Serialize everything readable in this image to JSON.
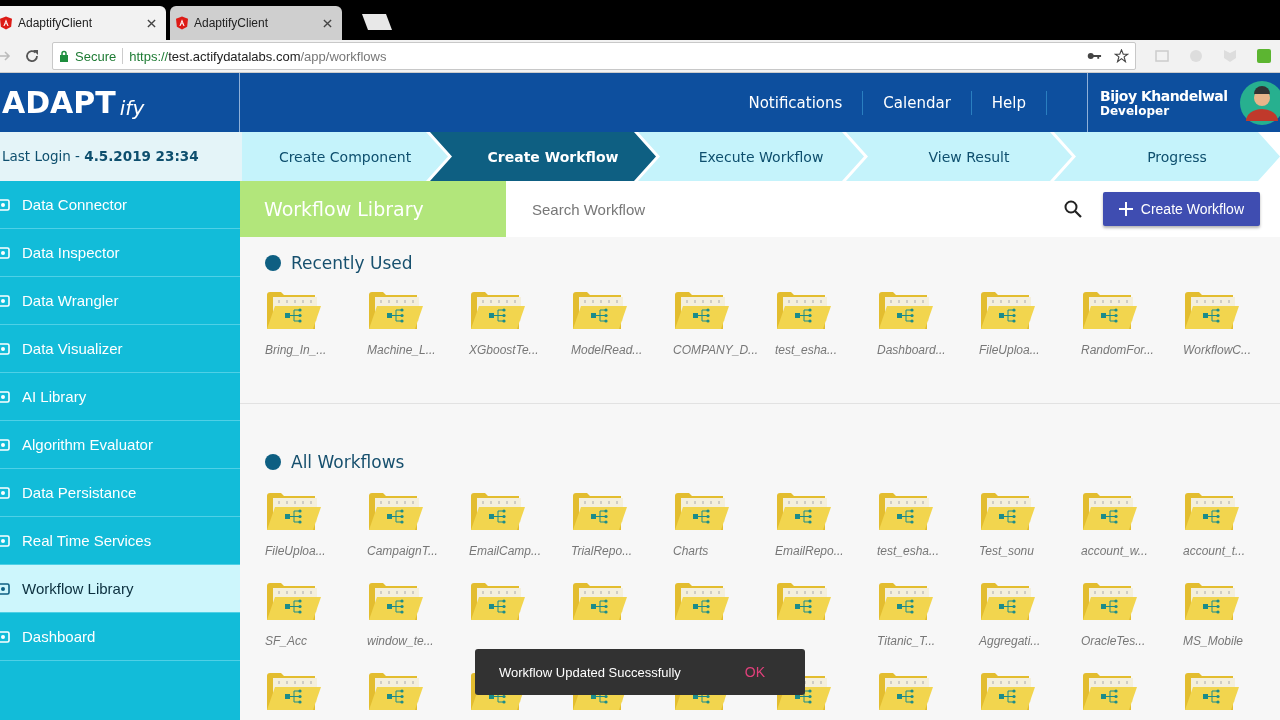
{
  "browser": {
    "tabs": [
      {
        "title": "AdaptifyClient",
        "selected": true
      },
      {
        "title": "AdaptifyClient",
        "selected": false
      }
    ],
    "secure_label": "Secure",
    "url_scheme": "https://",
    "url_host": "test.actifydatalabs.com",
    "url_path": "/app/workflows"
  },
  "header": {
    "logo_main": "ADAPT",
    "logo_suffix": "ify",
    "nav": [
      "Notifications",
      "Calendar",
      "Help"
    ],
    "user_name": "Bijoy Khandelwal",
    "user_role": "Developer"
  },
  "last_login": "Last Login - **4.5.2019 23:34**",
  "steps": [
    {
      "label": "Create Component",
      "selected": false
    },
    {
      "label": "Create Workflow",
      "selected": true
    },
    {
      "label": "Execute Workflow",
      "selected": false
    },
    {
      "label": "View Result",
      "selected": false
    },
    {
      "label": "Progress",
      "selected": false
    }
  ],
  "sidebar": {
    "items": [
      {
        "label": "Data Connector",
        "selected": false
      },
      {
        "label": "Data Inspector",
        "selected": false
      },
      {
        "label": "Data Wrangler",
        "selected": false
      },
      {
        "label": "Data Visualizer",
        "selected": false
      },
      {
        "label": "AI Library",
        "selected": false
      },
      {
        "label": "Algorithm Evaluator",
        "selected": false
      },
      {
        "label": "Data Persistance",
        "selected": false
      },
      {
        "label": "Real Time Services",
        "selected": false
      },
      {
        "label": "Workflow Library",
        "selected": true
      },
      {
        "label": "Dashboard",
        "selected": false
      }
    ]
  },
  "library": {
    "title": "Workflow Library",
    "search": {
      "placeholder": "Search Workflow"
    },
    "create_button": "Create Workflow",
    "sections": [
      {
        "title": "Recently Used",
        "items": [
          {
            "kind": "folder",
            "label": "Bring_In_..."
          },
          {
            "kind": "folder",
            "label": "Machine_L..."
          },
          {
            "kind": "folder",
            "label": "XGboostTe..."
          },
          {
            "kind": "folder",
            "label": "ModelRead..."
          },
          {
            "kind": "folder",
            "label": "COMPANY_D..."
          },
          {
            "kind": "folder",
            "label": "test_esha..."
          },
          {
            "kind": "folder",
            "label": "Dashboard..."
          },
          {
            "kind": "folder",
            "label": "FileUploa..."
          },
          {
            "kind": "folder",
            "label": "RandomFor..."
          },
          {
            "kind": "folder",
            "label": "WorkflowC..."
          }
        ]
      },
      {
        "title": "All Workflows",
        "items": [
          {
            "kind": "folder",
            "label": "FileUploa..."
          },
          {
            "kind": "folder",
            "label": "CampaignT..."
          },
          {
            "kind": "folder",
            "label": "EmailCamp..."
          },
          {
            "kind": "folder",
            "label": "TrialRepo..."
          },
          {
            "kind": "folder",
            "label": "Charts"
          },
          {
            "kind": "folder",
            "label": "EmailRepo..."
          },
          {
            "kind": "folder",
            "label": "test_esha..."
          },
          {
            "kind": "folder",
            "label": "Test_sonu"
          },
          {
            "kind": "folder",
            "label": "account_w..."
          },
          {
            "kind": "folder",
            "label": "account_t..."
          },
          {
            "kind": "folder",
            "label": "SF_Acc"
          },
          {
            "kind": "folder",
            "label": "window_te..."
          },
          {
            "kind": "folder"
          },
          {
            "kind": "folder"
          },
          {
            "kind": "folder"
          },
          {
            "kind": "folder"
          },
          {
            "kind": "folder",
            "label": "Titanic_T..."
          },
          {
            "kind": "folder",
            "label": "Aggregati..."
          },
          {
            "kind": "folder",
            "label": "OracleTes..."
          },
          {
            "kind": "folder",
            "label": "MS_Mobile"
          },
          {
            "kind": "folder"
          },
          {
            "kind": "folder"
          },
          {
            "kind": "folder"
          },
          {
            "kind": "folder"
          },
          {
            "kind": "folder"
          },
          {
            "kind": "folder"
          },
          {
            "kind": "folder"
          },
          {
            "kind": "folder"
          },
          {
            "kind": "folder"
          },
          {
            "kind": "folder"
          }
        ]
      }
    ]
  },
  "snackbar": {
    "message": "Workflow Updated Successfully",
    "action": "OK"
  }
}
